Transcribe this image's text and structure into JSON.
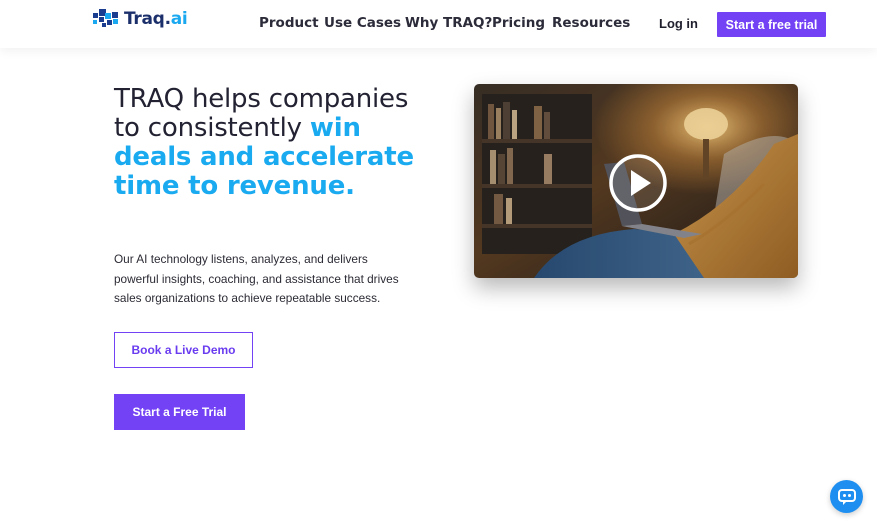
{
  "brand": {
    "name_main": "Traq",
    "name_dot": ".",
    "name_suffix": "ai",
    "logo_icon": "pixel-mosaic-icon"
  },
  "nav": {
    "items": [
      {
        "label": "Product"
      },
      {
        "label": "Use Cases"
      },
      {
        "label": "Why TRAQ?"
      },
      {
        "label": "Pricing"
      },
      {
        "label": "Resources"
      }
    ],
    "login_label": "Log in",
    "cta_label": "Start a free trial"
  },
  "hero": {
    "headline_plain": "TRAQ helps companies to consistently",
    "headline_highlight": "win deals and accelerate time to revenue.",
    "description": "Our AI technology listens, analyzes, and delivers powerful insights, coaching, and assistance that drives sales organizations to achieve repeatable success.",
    "demo_button": "Book a Live Demo",
    "trial_button": "Start a Free Trial"
  },
  "video": {
    "thumbnail": "person-with-laptop-in-cozy-room",
    "play_icon": "play-icon"
  },
  "chat": {
    "icon": "chat-bot-icon"
  },
  "colors": {
    "accent_purple": "#7342f5",
    "highlight_blue": "#1aaaf0",
    "logo_navy": "#1b2f6b",
    "chat_blue": "#1e8ff0"
  }
}
